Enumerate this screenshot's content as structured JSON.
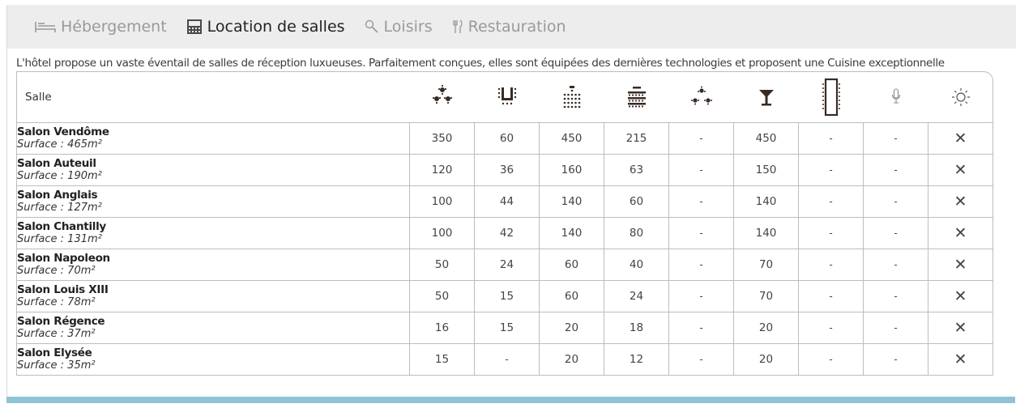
{
  "tabs": [
    {
      "label": "Hébergement",
      "icon": "bed-icon",
      "active": false
    },
    {
      "label": "Location de salles",
      "icon": "meeting-room-icon",
      "active": true
    },
    {
      "label": "Loisirs",
      "icon": "magnifier-icon",
      "active": false
    },
    {
      "label": "Restauration",
      "icon": "cutlery-icon",
      "active": false
    }
  ],
  "intro": "L'hôtel propose un vaste éventail de salles de réception luxueuses. Parfaitement conçues, elles sont équipées des dernières technologies et proposent une Cuisine exceptionnelle",
  "table": {
    "col_name_header": "Salle",
    "header_icons": [
      "cabaret-icon",
      "u-shape-icon",
      "theatre-icon",
      "classroom-icon",
      "banquet-icon",
      "cocktail-icon",
      "boardroom-icon",
      "microphone-icon",
      "daylight-icon"
    ],
    "rows": [
      {
        "name": "Salon Vendôme",
        "surface": "Surface : 465m²",
        "values": [
          "350",
          "60",
          "450",
          "215",
          "-",
          "450",
          "-",
          "-",
          "✕"
        ]
      },
      {
        "name": "Salon Auteuil",
        "surface": "Surface : 190m²",
        "values": [
          "120",
          "36",
          "160",
          "63",
          "-",
          "150",
          "-",
          "-",
          "✕"
        ]
      },
      {
        "name": "Salon Anglais",
        "surface": "Surface : 127m²",
        "values": [
          "100",
          "44",
          "140",
          "60",
          "-",
          "140",
          "-",
          "-",
          "✕"
        ]
      },
      {
        "name": "Salon Chantilly",
        "surface": "Surface : 131m²",
        "values": [
          "100",
          "42",
          "140",
          "80",
          "-",
          "140",
          "-",
          "-",
          "✕"
        ]
      },
      {
        "name": "Salon Napoleon",
        "surface": "Surface : 70m²",
        "values": [
          "50",
          "24",
          "60",
          "40",
          "-",
          "70",
          "-",
          "-",
          "✕"
        ]
      },
      {
        "name": "Salon Louis XIII",
        "surface": "Surface : 78m²",
        "values": [
          "50",
          "15",
          "60",
          "24",
          "-",
          "70",
          "-",
          "-",
          "✕"
        ]
      },
      {
        "name": "Salon Régence",
        "surface": "Surface : 37m²",
        "values": [
          "16",
          "15",
          "20",
          "18",
          "-",
          "20",
          "-",
          "-",
          "✕"
        ]
      },
      {
        "name": "Salon Elysée",
        "surface": "Surface : 35m²",
        "values": [
          "15",
          "-",
          "20",
          "12",
          "-",
          "20",
          "-",
          "-",
          "✕"
        ]
      }
    ]
  },
  "colors": {
    "accent_bar": "#8fc3d6",
    "icon_dark": "#3a2a24",
    "tab_bg": "#ededed"
  }
}
